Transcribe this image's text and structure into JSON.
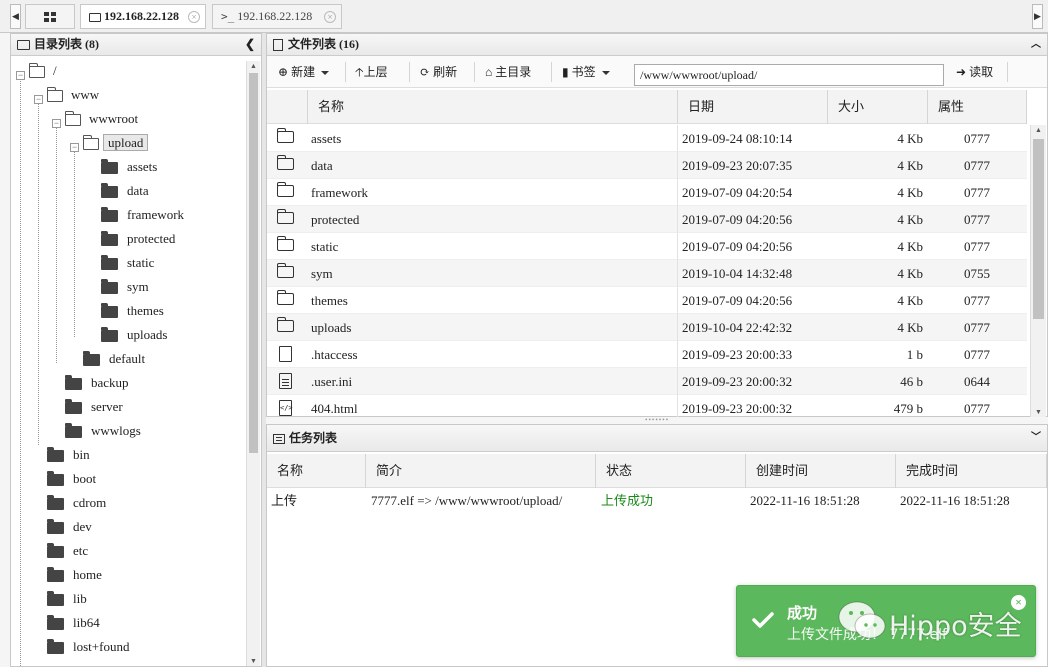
{
  "tabs": [
    {
      "label": "192.168.22.128",
      "icon": "folder-icon",
      "active": true
    },
    {
      "label": "192.168.22.128",
      "icon": "terminal-icon",
      "active": false
    }
  ],
  "tree_panel": {
    "title": "目录列表 (8)",
    "nodes": [
      {
        "label": "/",
        "state": "open"
      },
      {
        "label": "www",
        "state": "open"
      },
      {
        "label": "wwwroot",
        "state": "open"
      },
      {
        "label": "upload",
        "state": "open",
        "selected": true
      },
      {
        "label": "assets",
        "state": "closed"
      },
      {
        "label": "data",
        "state": "closed"
      },
      {
        "label": "framework",
        "state": "closed"
      },
      {
        "label": "protected",
        "state": "closed"
      },
      {
        "label": "static",
        "state": "closed"
      },
      {
        "label": "sym",
        "state": "closed"
      },
      {
        "label": "themes",
        "state": "closed"
      },
      {
        "label": "uploads",
        "state": "closed"
      },
      {
        "label": "default",
        "state": "closed"
      },
      {
        "label": "backup",
        "state": "closed"
      },
      {
        "label": "server",
        "state": "closed"
      },
      {
        "label": "wwwlogs",
        "state": "closed"
      },
      {
        "label": "bin",
        "state": "closed"
      },
      {
        "label": "boot",
        "state": "closed"
      },
      {
        "label": "cdrom",
        "state": "closed"
      },
      {
        "label": "dev",
        "state": "closed"
      },
      {
        "label": "etc",
        "state": "closed"
      },
      {
        "label": "home",
        "state": "closed"
      },
      {
        "label": "lib",
        "state": "closed"
      },
      {
        "label": "lib64",
        "state": "closed"
      },
      {
        "label": "lost+found",
        "state": "closed"
      }
    ]
  },
  "file_panel": {
    "title": "文件列表 (16)",
    "toolbar": {
      "new_label": "新建",
      "up_label": "上层",
      "refresh_label": "刷新",
      "home_label": "主目录",
      "bookmark_label": "书签",
      "path_value": "/www/wwwroot/upload/",
      "read_label": "读取"
    },
    "columns": [
      "名称",
      "日期",
      "大小",
      "属性"
    ],
    "rows": [
      {
        "name": "assets",
        "date": "2019-09-24 08:10:14",
        "size": "4 Kb",
        "perm": "0777",
        "type": "folder"
      },
      {
        "name": "data",
        "date": "2019-09-23 20:07:35",
        "size": "4 Kb",
        "perm": "0777",
        "type": "folder"
      },
      {
        "name": "framework",
        "date": "2019-07-09 04:20:54",
        "size": "4 Kb",
        "perm": "0777",
        "type": "folder"
      },
      {
        "name": "protected",
        "date": "2019-07-09 04:20:56",
        "size": "4 Kb",
        "perm": "0777",
        "type": "folder"
      },
      {
        "name": "static",
        "date": "2019-07-09 04:20:56",
        "size": "4 Kb",
        "perm": "0777",
        "type": "folder"
      },
      {
        "name": "sym",
        "date": "2019-10-04 14:32:48",
        "size": "4 Kb",
        "perm": "0755",
        "type": "folder"
      },
      {
        "name": "themes",
        "date": "2019-07-09 04:20:56",
        "size": "4 Kb",
        "perm": "0777",
        "type": "folder"
      },
      {
        "name": "uploads",
        "date": "2019-10-04 22:42:32",
        "size": "4 Kb",
        "perm": "0777",
        "type": "folder"
      },
      {
        "name": ".htaccess",
        "date": "2019-09-23 20:00:33",
        "size": "1 b",
        "perm": "0777",
        "type": "file"
      },
      {
        "name": ".user.ini",
        "date": "2019-09-23 20:00:32",
        "size": "46 b",
        "perm": "0644",
        "type": "text"
      },
      {
        "name": "404.html",
        "date": "2019-09-23 20:00:32",
        "size": "479 b",
        "perm": "0777",
        "type": "code"
      }
    ]
  },
  "task_panel": {
    "title": "任务列表",
    "columns": [
      "名称",
      "简介",
      "状态",
      "创建时间",
      "完成时间"
    ],
    "rows": [
      {
        "name": "上传",
        "desc": "7777.elf => /www/wwwroot/upload/",
        "status": "上传成功",
        "created": "2022-11-16 18:51:28",
        "finished": "2022-11-16 18:51:28"
      }
    ]
  },
  "toast": {
    "title": "成功",
    "message": "上传文件成功！ 7777.elf",
    "color": "#5cb85c"
  },
  "watermark": {
    "text": "Hippo安全"
  }
}
